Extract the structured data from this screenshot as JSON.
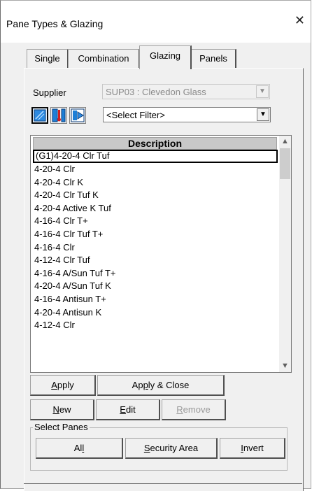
{
  "window": {
    "title": "Pane Types & Glazing",
    "close_glyph": "✕"
  },
  "tabs": [
    {
      "label": "Single",
      "active": false
    },
    {
      "label": "Combination",
      "active": false
    },
    {
      "label": "Glazing",
      "active": true
    },
    {
      "label": "Panels",
      "active": false
    }
  ],
  "supplier": {
    "label": "Supplier",
    "value": "SUP03 : Clevedon Glass",
    "enabled": false
  },
  "filter": {
    "value": "<Select Filter>"
  },
  "icons": [
    "glass-pane-icon",
    "thermometer-icon",
    "security-pane-icon"
  ],
  "list": {
    "header": "Description",
    "selected_index": 0,
    "rows": [
      "(G1)4-20-4 Clr Tuf",
      "4-20-4 Clr",
      "4-20-4 Clr K",
      "4-20-4 Clr Tuf K",
      "4-20-4 Active K Tuf",
      "4-16-4 Clr T+",
      "4-16-4 Clr Tuf T+",
      "4-16-4 Clr",
      "4-12-4 Clr Tuf",
      "4-16-4 A/Sun Tuf T+",
      "4-20-4 A/Sun Tuf K",
      "4-16-4 Antisun T+",
      "4-20-4 Antisun K",
      "4-12-4 Clr"
    ]
  },
  "buttons": {
    "apply": "Apply",
    "apply_close": "Apply & Close",
    "new": "New",
    "edit": "Edit",
    "remove": "Remove"
  },
  "select_panes": {
    "legend": "Select Panes",
    "all": "All",
    "security_area": "Security Area",
    "invert": "Invert"
  },
  "colors": {
    "accent": "#0078d7",
    "icon_blue": "#1e7fd6",
    "icon_red": "#d21e1e"
  }
}
